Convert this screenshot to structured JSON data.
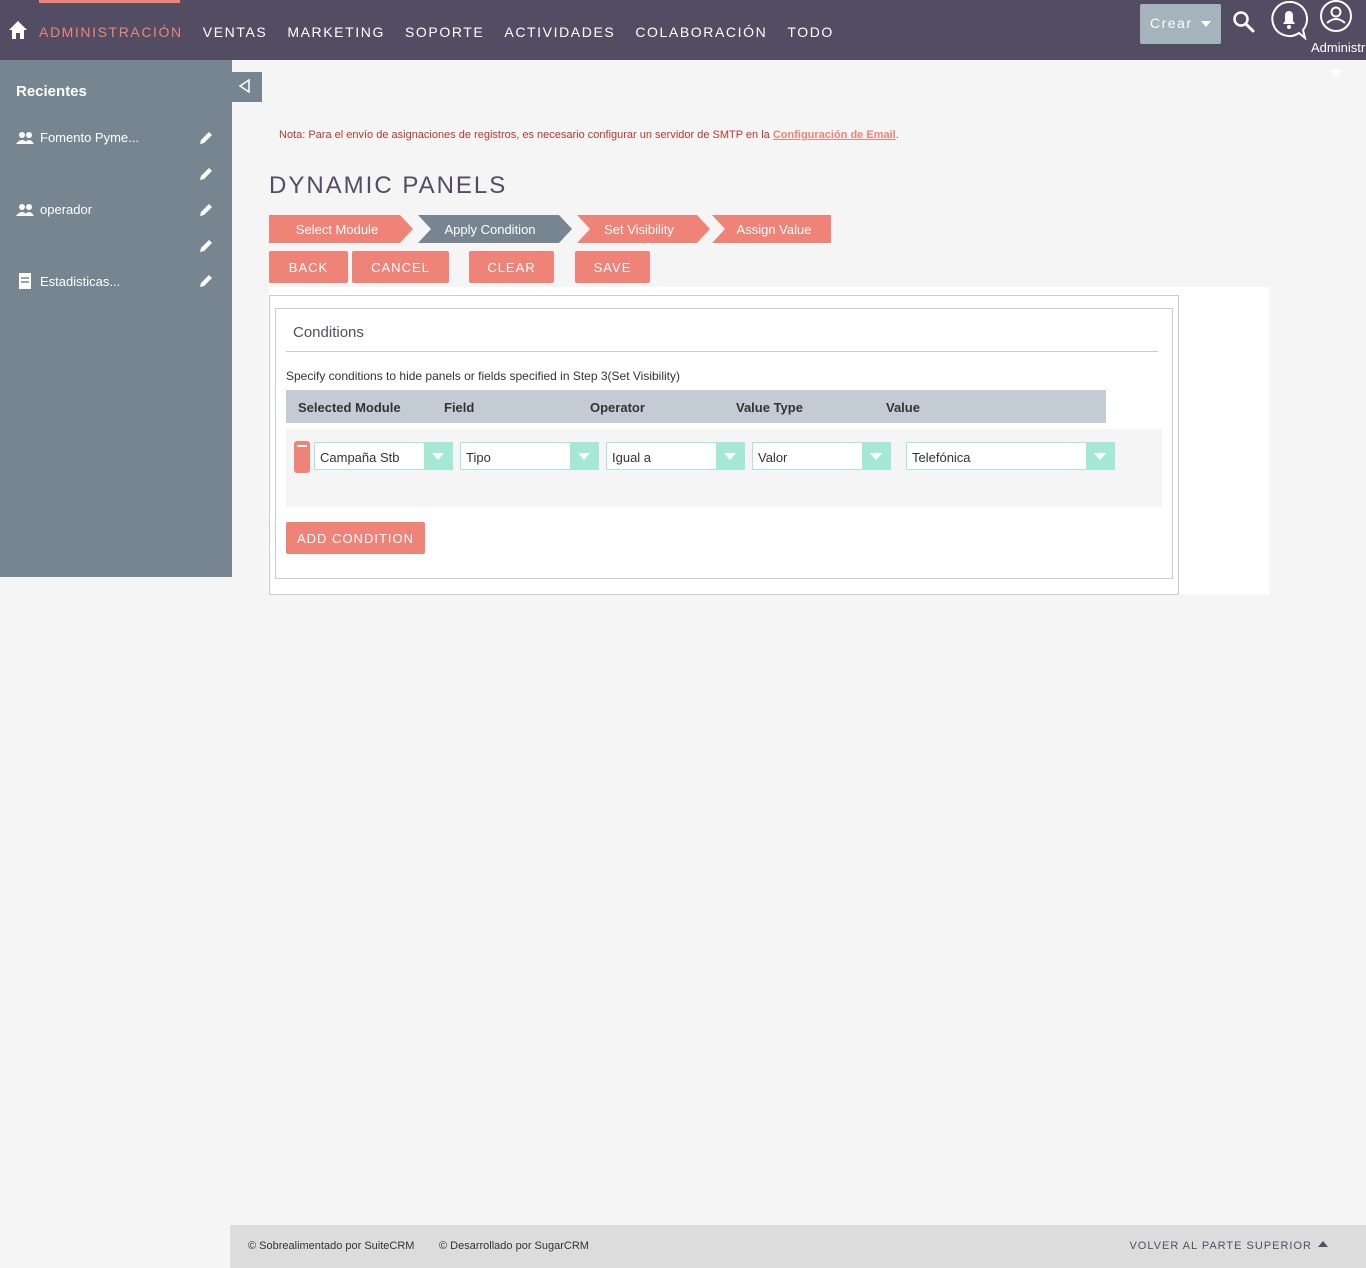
{
  "nav": {
    "items": [
      "ADMINISTRACIÓN",
      "VENTAS",
      "MARKETING",
      "SOPORTE",
      "ACTIVIDADES",
      "COLABORACIÓN",
      "TODO"
    ],
    "crear_label": "Crear",
    "user_label": "Administr"
  },
  "sidebar": {
    "title": "Recientes",
    "items": [
      {
        "label": "Fomento Pyme...",
        "icon": "users-icon"
      },
      {
        "label": "operador",
        "icon": "users-icon"
      },
      {
        "label": "Estadisticas...",
        "icon": "document-icon"
      }
    ]
  },
  "note": {
    "text": "Nota: Para el envío de asignaciones de registros, es necesario configurar un servidor de SMTP en la ",
    "link": "Configuración de Email",
    "end": "."
  },
  "page_title": "DYNAMIC PANELS",
  "steps": [
    "Select Module",
    "Apply Condition",
    "Set Visibility",
    "Assign Value"
  ],
  "buttons": {
    "back": "BACK",
    "cancel": "CANCEL",
    "clear": "CLEAR",
    "save": "SAVE"
  },
  "panel": {
    "title": "Conditions",
    "description": "Specify conditions to hide panels or fields specified in Step 3(Set Visibility)",
    "headers": [
      "Selected Module",
      "Field",
      "Operator",
      "Value Type",
      "Value"
    ],
    "row": {
      "module": "Campaña Stb",
      "field": "Tipo",
      "operator": "Igual a",
      "value_type": "Valor",
      "value": "Telefónica"
    },
    "add_label": "ADD CONDITION"
  },
  "footer": {
    "powered": "© Sobrealimentado por SuiteCRM",
    "developed": "© Desarrollado por SugarCRM",
    "back_top": "VOLVER AL PARTE SUPERIOR"
  },
  "colors": {
    "nav": "#534d64",
    "accent": "#f08377",
    "sidebar": "#778591",
    "select": "#a5e8d6"
  }
}
